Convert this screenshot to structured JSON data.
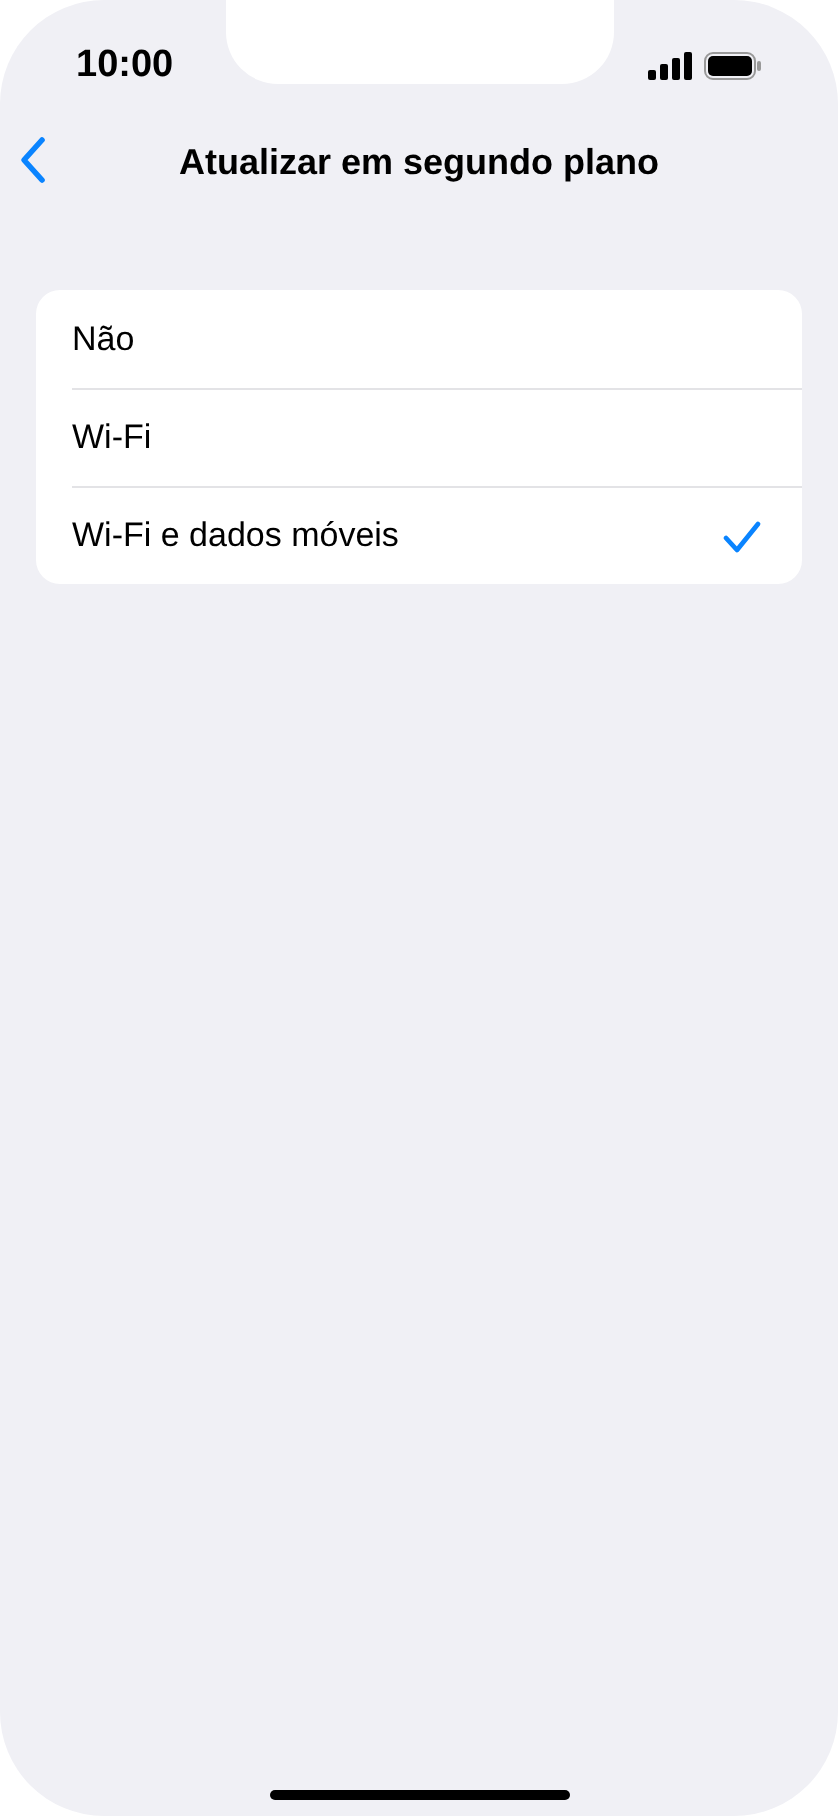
{
  "status_bar": {
    "time": "10:00"
  },
  "nav": {
    "title": "Atualizar em segundo plano"
  },
  "options": [
    {
      "label": "Não",
      "selected": false
    },
    {
      "label": "Wi-Fi",
      "selected": false
    },
    {
      "label": "Wi-Fi e dados móveis",
      "selected": true
    }
  ]
}
